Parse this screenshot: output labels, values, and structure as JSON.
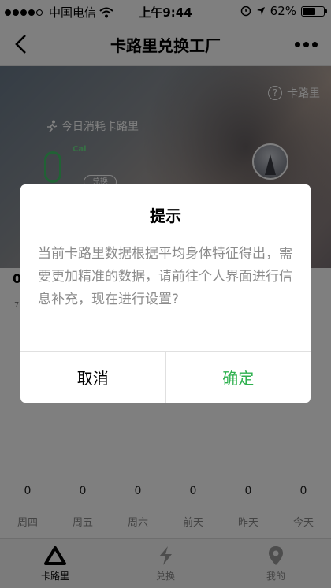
{
  "status_bar": {
    "carrier": "中国电信",
    "time": "上午9:44",
    "battery": "62%",
    "battery_level": 0.62
  },
  "nav": {
    "title": "卡路里兑换工厂"
  },
  "hero": {
    "help_label": "卡路里",
    "today_label": "今日消耗卡路里",
    "unit": "Cal",
    "redeem_label": "兑换"
  },
  "stats": {
    "value": "0",
    "small": "7"
  },
  "week": {
    "values": [
      "0",
      "0",
      "0",
      "0",
      "0",
      "0"
    ],
    "labels": [
      "周四",
      "周五",
      "周六",
      "前天",
      "昨天",
      "今天"
    ]
  },
  "tabs": [
    {
      "label": "卡路里",
      "icon": "triangle-icon"
    },
    {
      "label": "兑换",
      "icon": "lightning-icon"
    },
    {
      "label": "我的",
      "icon": "location-pin-icon"
    }
  ],
  "dialog": {
    "title": "提示",
    "message": "当前卡路里数据根据平均身体特征得出，需要更加精准的数据，请前往个人界面进行信息补充，现在进行设置?",
    "cancel_label": "取消",
    "confirm_label": "确定"
  },
  "colors": {
    "accent_green": "#2fb14f",
    "mask": "rgba(0,0,0,0.5)"
  }
}
